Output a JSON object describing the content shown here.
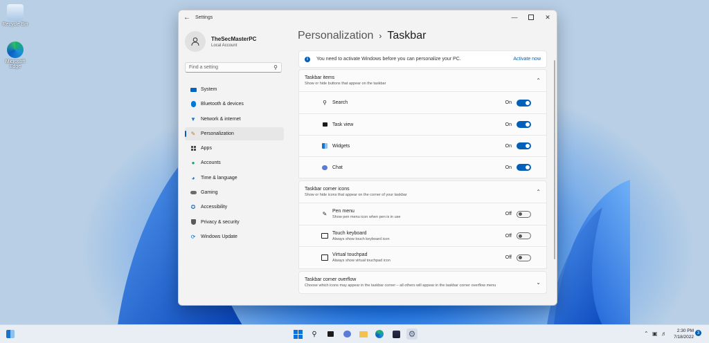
{
  "desktop": {
    "icons": [
      {
        "label": "Recycle Bin",
        "icon": "recycle-bin-icon"
      },
      {
        "label": "Microsoft Edge",
        "icon": "edge-icon"
      }
    ]
  },
  "window": {
    "app_title": "Settings",
    "back_icon": "back-arrow-icon",
    "controls": [
      "minimize",
      "maximize",
      "close"
    ]
  },
  "profile": {
    "name": "TheSecMasterPC",
    "account_type": "Local Account"
  },
  "search": {
    "placeholder": "Find a setting"
  },
  "nav": {
    "items": [
      {
        "label": "System",
        "icon": "system-icon",
        "color": "#0067c0"
      },
      {
        "label": "Bluetooth & devices",
        "icon": "bluetooth-icon",
        "color": "#0078d4"
      },
      {
        "label": "Network & internet",
        "icon": "wifi-icon",
        "color": "#1a73c7"
      },
      {
        "label": "Personalization",
        "icon": "brush-icon",
        "color": "#c47a2a",
        "selected": true
      },
      {
        "label": "Apps",
        "icon": "apps-icon",
        "color": "#4a4a4a"
      },
      {
        "label": "Accounts",
        "icon": "accounts-icon",
        "color": "#1f9e6e"
      },
      {
        "label": "Time & language",
        "icon": "globe-clock-icon",
        "color": "#1a73c7"
      },
      {
        "label": "Gaming",
        "icon": "gamepad-icon",
        "color": "#6b6b6b"
      },
      {
        "label": "Accessibility",
        "icon": "accessibility-icon",
        "color": "#1a73c7"
      },
      {
        "label": "Privacy & security",
        "icon": "shield-icon",
        "color": "#5a5a5a"
      },
      {
        "label": "Windows Update",
        "icon": "update-icon",
        "color": "#0067c0"
      }
    ]
  },
  "header": {
    "parent": "Personalization",
    "separator": "›",
    "current": "Taskbar"
  },
  "banner": {
    "message": "You need to activate Windows before you can personalize your PC.",
    "action": "Activate now"
  },
  "taskbar_items": {
    "title": "Taskbar items",
    "subtitle": "Show or hide buttons that appear on the taskbar",
    "rows": [
      {
        "label": "Search",
        "icon": "search-icon",
        "state": "On",
        "on": true
      },
      {
        "label": "Task view",
        "icon": "task-view-icon",
        "state": "On",
        "on": true
      },
      {
        "label": "Widgets",
        "icon": "widgets-icon",
        "state": "On",
        "on": true
      },
      {
        "label": "Chat",
        "icon": "chat-icon",
        "state": "On",
        "on": true
      }
    ]
  },
  "corner_icons": {
    "title": "Taskbar corner icons",
    "subtitle": "Show or hide icons that appear on the corner of your taskbar",
    "rows": [
      {
        "label": "Pen menu",
        "sub": "Show pen menu icon when pen is in use",
        "icon": "pen-icon",
        "state": "Off",
        "on": false
      },
      {
        "label": "Touch keyboard",
        "sub": "Always show touch keyboard icon",
        "icon": "keyboard-icon",
        "state": "Off",
        "on": false
      },
      {
        "label": "Virtual touchpad",
        "sub": "Always show virtual touchpad icon",
        "icon": "touchpad-icon",
        "state": "Off",
        "on": false
      }
    ]
  },
  "overflow": {
    "title": "Taskbar corner overflow",
    "subtitle": "Choose which icons may appear in the taskbar corner – all others will appear in the taskbar corner overflow menu"
  },
  "taskbar": {
    "time": "2:30 PM",
    "date": "7/18/2022",
    "notification_count": "3",
    "accent": "#005fb8"
  }
}
